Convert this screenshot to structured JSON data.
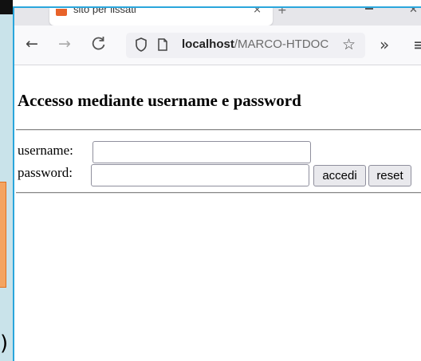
{
  "browser": {
    "tab_title": "sito per iissati",
    "tab_close": "×",
    "new_tab": "+",
    "close_window": "✕",
    "nav": {
      "back": "←",
      "forward": "→",
      "reload": "C"
    },
    "url": {
      "host": "localhost",
      "path": "/MARCO-HTDOC"
    },
    "bookmark": "☆",
    "overflow": "»",
    "menu": "≡"
  },
  "page": {
    "title": "Accesso mediante username e password",
    "form": {
      "username_label": "username:",
      "username_value": "",
      "password_label": "password:",
      "password_value": "",
      "submit_label": "accedi",
      "reset_label": "reset"
    }
  },
  "backdrop": {
    "glyph": ")"
  },
  "colors": {
    "window_border": "#2aa6dc",
    "favicon": "#e8632a",
    "backdrop": "#c9e3ea"
  }
}
